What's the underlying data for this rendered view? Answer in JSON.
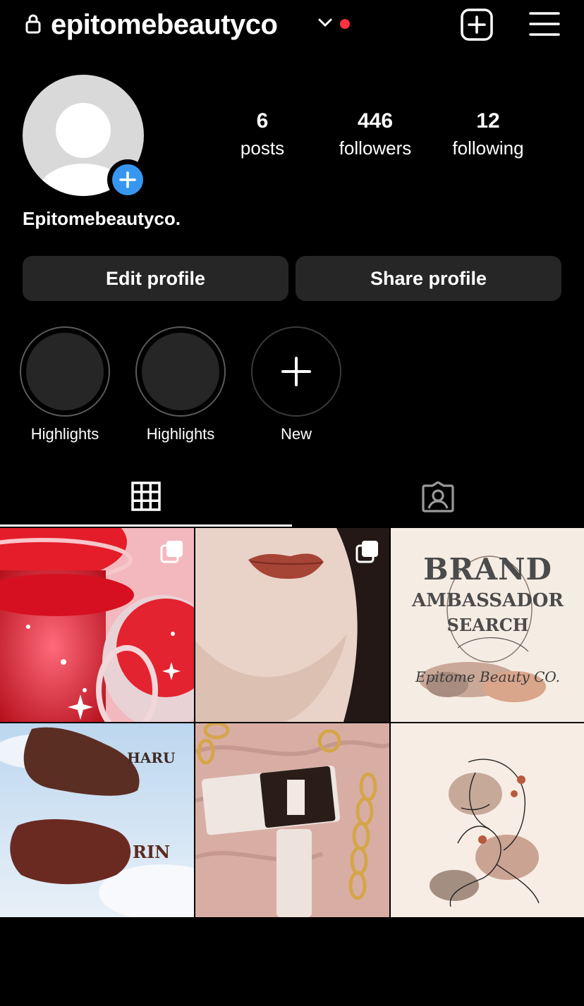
{
  "header": {
    "username": "epitomebeautyco",
    "lock_icon": "lock-icon",
    "switch_account_icon": "chevron-down-icon",
    "notification_dot_color": "#ff3040",
    "new_post_icon": "plus-square-icon",
    "menu_icon": "hamburger-menu-icon"
  },
  "profile": {
    "display_name": "Epitomebeautyco.",
    "avatar_icon": "default-avatar-icon",
    "add_story_icon": "plus-circle-icon",
    "stats": [
      {
        "value": "6",
        "label": "posts"
      },
      {
        "value": "446",
        "label": "followers"
      },
      {
        "value": "12",
        "label": "following"
      }
    ]
  },
  "buttons": {
    "edit": "Edit profile",
    "share": "Share profile"
  },
  "highlights": [
    {
      "label": "Highlights"
    },
    {
      "label": "Highlights"
    },
    {
      "label": "New"
    }
  ],
  "tabs": [
    {
      "name": "posts-grid",
      "icon": "grid-icon",
      "active": true
    },
    {
      "name": "tagged",
      "icon": "tagged-person-icon",
      "active": false
    }
  ],
  "posts": [
    {
      "id": "red-glitter-jars",
      "multi": true
    },
    {
      "id": "lip-portrait",
      "multi": true
    },
    {
      "id": "brand-ambassador",
      "multi": false,
      "text_lines": [
        "BRAND",
        "AMBASSADOR",
        "SEARCH"
      ],
      "script_text": "Epitome Beauty CO."
    },
    {
      "id": "swatches",
      "multi": false,
      "text_lines": [
        "HARU",
        "RIN"
      ]
    },
    {
      "id": "lip-product",
      "multi": false
    },
    {
      "id": "line-art",
      "multi": false
    }
  ],
  "colors": {
    "accent_blue": "#3797f0",
    "button_bg": "#262626",
    "background": "#000000"
  }
}
